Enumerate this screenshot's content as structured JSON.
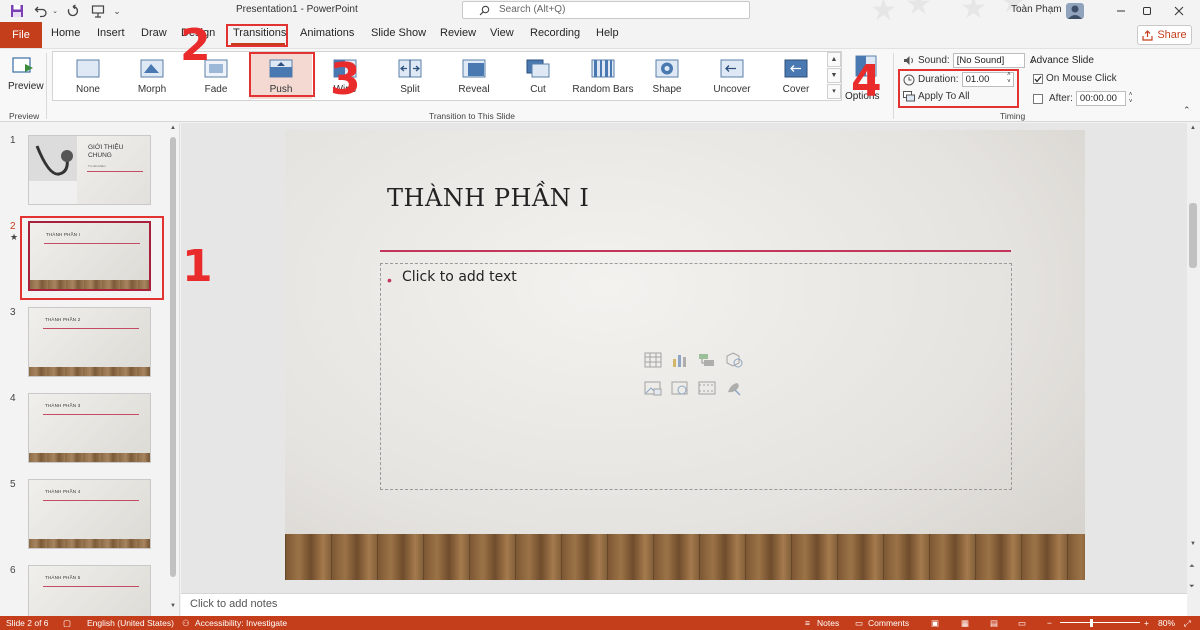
{
  "titlebar": {
    "doc_title": "Presentation1  -  PowerPoint",
    "search_placeholder": "Search (Alt+Q)",
    "user_name": "Toàn Phạm"
  },
  "tabs": {
    "file": "File",
    "items": [
      "Home",
      "Insert",
      "Draw",
      "Design",
      "Transitions",
      "Animations",
      "Slide Show",
      "Review",
      "View",
      "Recording",
      "Help"
    ],
    "active": "Transitions",
    "share": "Share"
  },
  "ribbon": {
    "preview_label": "Preview",
    "preview_group": "Preview",
    "transitions": [
      "None",
      "Morph",
      "Fade",
      "Push",
      "Wipe",
      "Split",
      "Reveal",
      "Cut",
      "Random Bars",
      "Shape",
      "Uncover",
      "Cover"
    ],
    "selected_transition": "Push",
    "effect_options": "Options",
    "group_label": "Transition to This Slide",
    "timing": {
      "sound_label": "Sound:",
      "sound_value": "[No Sound]",
      "duration_label": "Duration:",
      "duration_value": "01.00",
      "apply_all": "Apply To All",
      "advance_label": "Advance Slide",
      "on_mouse_click": "On Mouse Click",
      "on_mouse_click_checked": true,
      "after_label": "After:",
      "after_value": "00:00.00",
      "after_checked": false,
      "group_label": "Timing"
    }
  },
  "annotations": [
    "1",
    "2",
    "3",
    "4"
  ],
  "thumbnails": [
    {
      "num": "1",
      "title": "GIỚI THIỆU CHUNG",
      "subtitle": "Tư vấn khám"
    },
    {
      "num": "2",
      "title": "THÀNH PHẦN I",
      "marker": "★"
    },
    {
      "num": "3",
      "title": "THÀNH PHẦN 2"
    },
    {
      "num": "4",
      "title": "THÀNH PHẦN 3"
    },
    {
      "num": "5",
      "title": "THÀNH PHẦN 4"
    },
    {
      "num": "6",
      "title": "THÀNH PHẦN 5"
    }
  ],
  "slide": {
    "title": "THÀNH PHẦN I",
    "content_placeholder": "Click to add text",
    "bullet": "•",
    "placeholder_icons": [
      "table-icon",
      "chart-icon",
      "smartart-icon",
      "3d-model-icon",
      "picture-icon",
      "online-picture-icon",
      "video-icon",
      "icons-icon"
    ]
  },
  "notes": {
    "placeholder": "Click to add notes"
  },
  "status": {
    "slide": "Slide 2 of 6",
    "language": "English (United States)",
    "accessibility": "Accessibility: Investigate",
    "notes": "Notes",
    "comments": "Comments",
    "zoom": "80%"
  },
  "colors": {
    "accent": "#c43e1c",
    "annotation_red": "#e23232",
    "slide_rule": "#c1365a"
  }
}
